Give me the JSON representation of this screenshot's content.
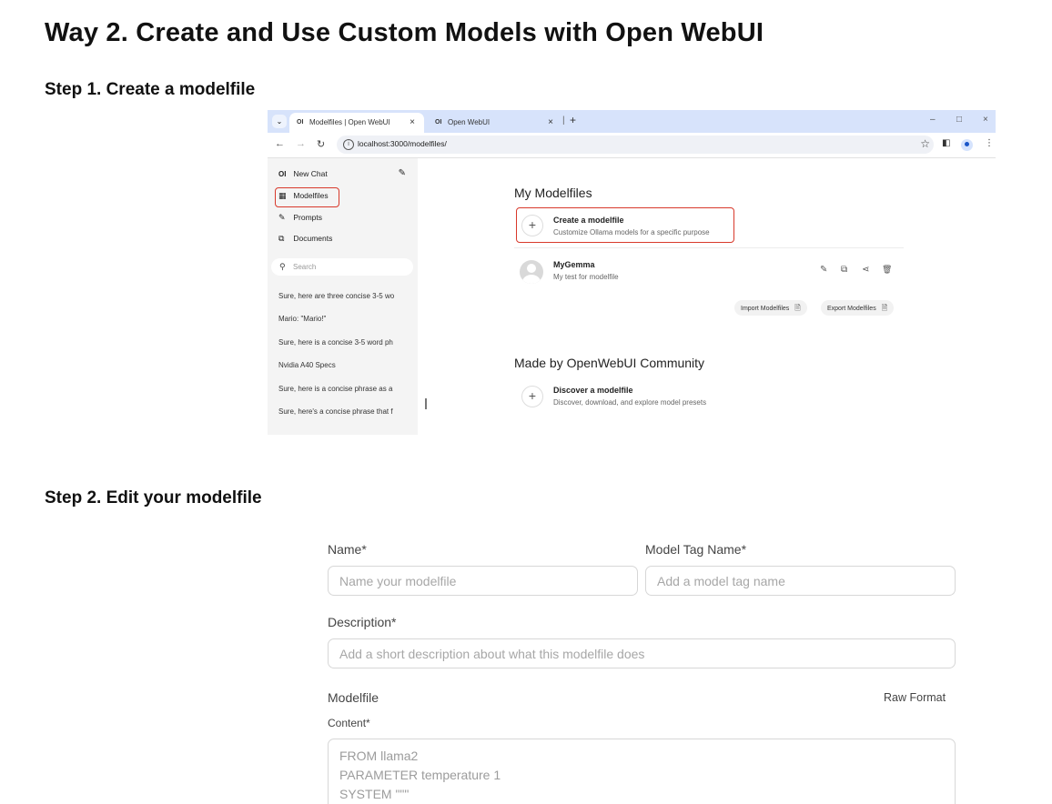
{
  "headings": {
    "title": "Way 2. Create and Use Custom Models with Open WebUI",
    "step1": "Step 1. Create a modelfile",
    "step2": "Step 2. Edit your modelfile"
  },
  "browser": {
    "tabs": [
      {
        "logo": "OI",
        "label": "Modelfiles | Open WebUI",
        "close": "×"
      },
      {
        "logo": "OI",
        "label": "Open WebUI",
        "close": "×"
      }
    ],
    "tab_dropdown": "⌄",
    "tab_separator": "|",
    "new_tab": "+",
    "window_controls": {
      "minimize": "–",
      "maximize": "□",
      "close": "×"
    },
    "nav": {
      "back": "←",
      "forward": "→",
      "reload": "↻"
    },
    "url": "localhost:3000/modelfiles/",
    "star": "☆",
    "side_panel_icon": "◧",
    "menu_icon": "⋮"
  },
  "sidebar": {
    "new_chat": {
      "logo": "OI",
      "label": "New Chat",
      "edit_icon": "✎"
    },
    "items": [
      {
        "icon": "▦",
        "label": "Modelfiles"
      },
      {
        "icon": "✎",
        "label": "Prompts"
      },
      {
        "icon": "⧉",
        "label": "Documents"
      }
    ],
    "search": {
      "icon": "⚲",
      "placeholder": "Search"
    },
    "history": [
      "Sure, here are three concise 3-5 wo",
      "Mario: \"Mario!\"",
      "Sure, here is a concise 3-5 word ph",
      "Nvidia A40 Specs",
      "Sure, here is a concise phrase as a",
      "Sure, here's a concise phrase that f"
    ]
  },
  "main": {
    "my_modelfiles_title": "My Modelfiles",
    "create": {
      "icon": "+",
      "title": "Create a modelfile",
      "subtitle": "Customize Ollama models for a specific purpose"
    },
    "model": {
      "name": "MyGemma",
      "description": "My test for modelfile",
      "actions": [
        "✎",
        "⧉",
        "⋖",
        "🗑"
      ]
    },
    "import_label": "Import Modelfiles",
    "export_label": "Export Modelfiles",
    "file_icon": "🗎",
    "community_title": "Made by OpenWebUI Community",
    "discover": {
      "icon": "+",
      "title": "Discover a modelfile",
      "subtitle": "Discover, download, and explore model presets"
    }
  },
  "form": {
    "name_label": "Name*",
    "name_placeholder": "Name your modelfile",
    "tag_label": "Model Tag Name*",
    "tag_placeholder": "Add a model tag name",
    "description_label": "Description*",
    "description_placeholder": "Add a short description about what this modelfile does",
    "modelfile_label": "Modelfile",
    "raw_format": "Raw Format",
    "content_label": "Content*",
    "content_lines": [
      "FROM llama2",
      "PARAMETER temperature 1",
      "SYSTEM \"\"\""
    ]
  }
}
